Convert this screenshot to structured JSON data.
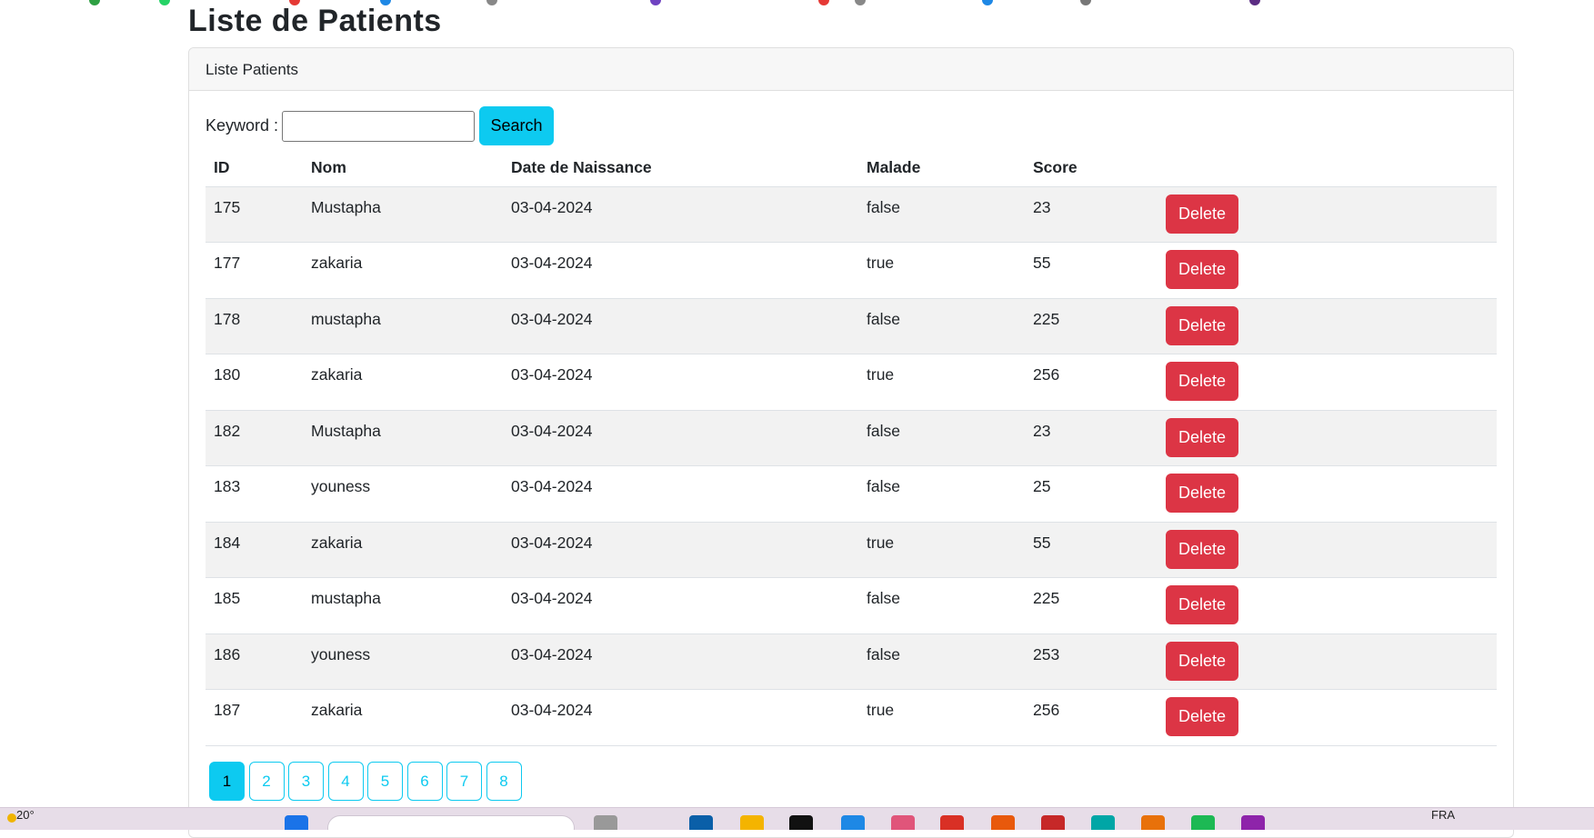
{
  "page": {
    "title": "Liste de Patients"
  },
  "card": {
    "header": "Liste Patients"
  },
  "search": {
    "label": "Keyword :",
    "value": "",
    "button_label": "Search"
  },
  "table": {
    "columns": [
      "ID",
      "Nom",
      "Date de Naissance",
      "Malade",
      "Score",
      ""
    ],
    "delete_label": "Delete",
    "rows": [
      {
        "id": "175",
        "nom": "Mustapha",
        "date": "03-04-2024",
        "malade": "false",
        "score": "23"
      },
      {
        "id": "177",
        "nom": "zakaria",
        "date": "03-04-2024",
        "malade": "true",
        "score": "55"
      },
      {
        "id": "178",
        "nom": "mustapha",
        "date": "03-04-2024",
        "malade": "false",
        "score": "225"
      },
      {
        "id": "180",
        "nom": "zakaria",
        "date": "03-04-2024",
        "malade": "true",
        "score": "256"
      },
      {
        "id": "182",
        "nom": "Mustapha",
        "date": "03-04-2024",
        "malade": "false",
        "score": "23"
      },
      {
        "id": "183",
        "nom": "youness",
        "date": "03-04-2024",
        "malade": "false",
        "score": "25"
      },
      {
        "id": "184",
        "nom": "zakaria",
        "date": "03-04-2024",
        "malade": "true",
        "score": "55"
      },
      {
        "id": "185",
        "nom": "mustapha",
        "date": "03-04-2024",
        "malade": "false",
        "score": "225"
      },
      {
        "id": "186",
        "nom": "youness",
        "date": "03-04-2024",
        "malade": "false",
        "score": "253"
      },
      {
        "id": "187",
        "nom": "zakaria",
        "date": "03-04-2024",
        "malade": "true",
        "score": "256"
      }
    ]
  },
  "pagination": {
    "pages": [
      "1",
      "2",
      "3",
      "4",
      "5",
      "6",
      "7",
      "8"
    ],
    "current": "1"
  },
  "taskbar": {
    "weather": "20°",
    "language": "FRA"
  },
  "colors": {
    "info": "#0dcaf0",
    "danger": "#dc3545",
    "stripe": "#f2f2f2"
  }
}
